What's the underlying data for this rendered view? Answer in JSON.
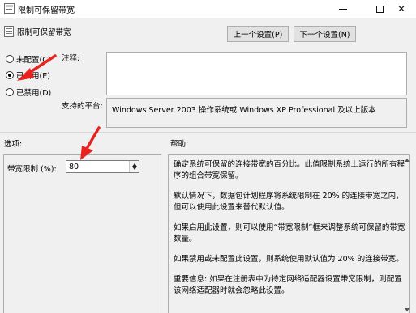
{
  "window": {
    "title": "限制可保留带宽",
    "minimize_glyph": "minimize-icon",
    "maximize_glyph": "maximize-icon",
    "close_glyph": "✕"
  },
  "header": {
    "title": "限制可保留带宽",
    "prev_button": "上一个设置(P)",
    "next_button": "下一个设置(N)"
  },
  "state": {
    "options": [
      {
        "label": "未配置(C)",
        "checked": false
      },
      {
        "label": "已启用(E)",
        "checked": true
      },
      {
        "label": "已禁用(D)",
        "checked": false
      }
    ]
  },
  "comment": {
    "label": "注释:",
    "value": ""
  },
  "supported": {
    "label": "支持的平台:",
    "value": "Windows Server 2003 操作系统或 Windows XP Professional 及以上版本"
  },
  "options_panel": {
    "label": "选项:",
    "bandwidth_label": "带宽限制 (%):",
    "bandwidth_value": "80"
  },
  "help_panel": {
    "label": "帮助:",
    "paragraphs": [
      "确定系统可保留的连接带宽的百分比。此值限制系统上运行的所有程序的组合带宽保留。",
      "默认情况下，数据包计划程序将系统限制在 20% 的连接带宽之内，但可以使用此设置来替代默认值。",
      "如果启用此设置，则可以使用“带宽限制”框来调整系统可保留的带宽数量。",
      "如果禁用或未配置此设置，则系统使用默认值为 20% 的连接带宽。",
      "重要信息: 如果在注册表中为特定网络适配器设置带宽限制，则配置该网络适配器时就会忽略此设置。"
    ]
  },
  "colors": {
    "annotation_arrow": "#e8231f",
    "background": "#f0f0f0"
  }
}
